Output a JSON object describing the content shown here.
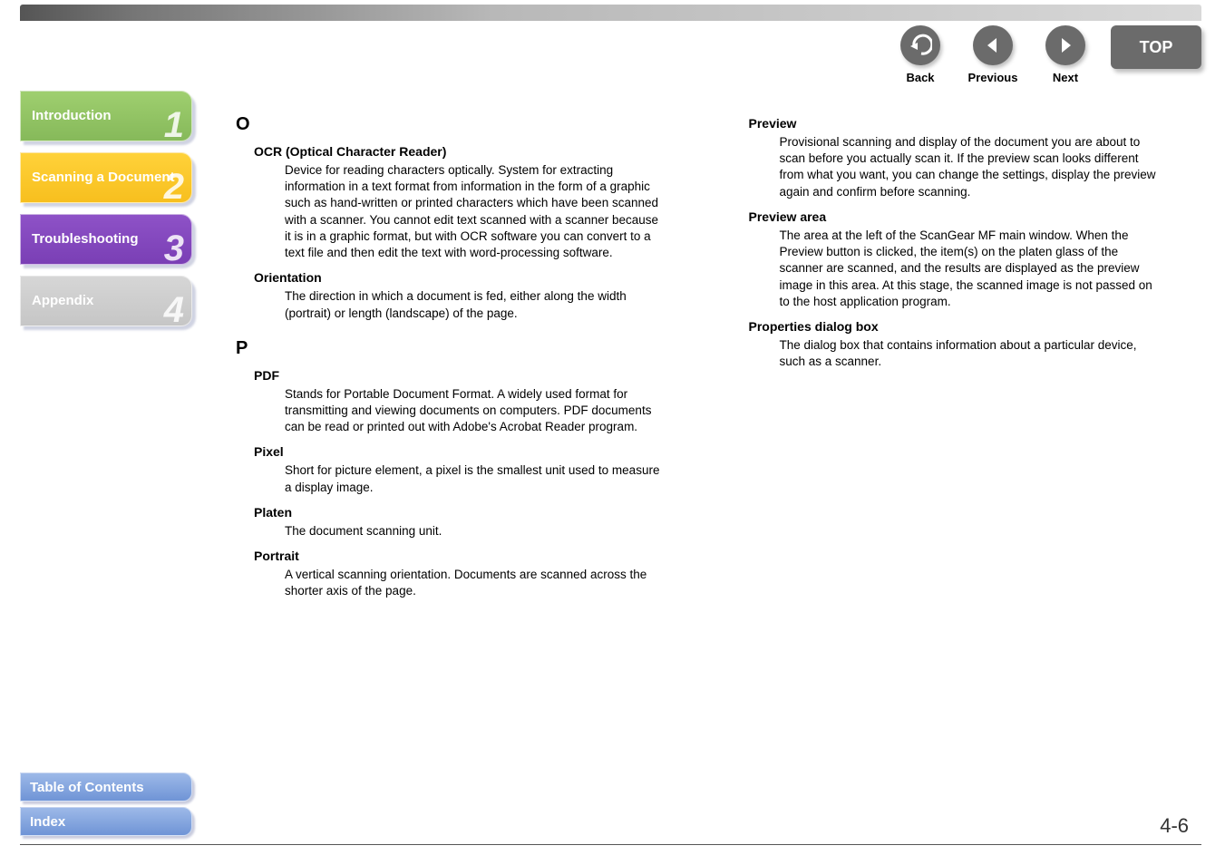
{
  "nav": {
    "back": {
      "label": "Back"
    },
    "previous": {
      "label": "Previous"
    },
    "next": {
      "label": "Next"
    },
    "top": {
      "label": "TOP"
    }
  },
  "sidebar": {
    "tabs": [
      {
        "label": "Introduction",
        "num": "1"
      },
      {
        "label": "Scanning a Document",
        "num": "2"
      },
      {
        "label": "Troubleshooting",
        "num": "3"
      },
      {
        "label": "Appendix",
        "num": "4"
      }
    ],
    "links": {
      "toc": "Table of Contents",
      "index": "Index"
    }
  },
  "glossary": {
    "left": {
      "letters": [
        {
          "letter": "O",
          "entries": [
            {
              "term": "OCR (Optical Character Reader)",
              "def": "Device for reading characters optically. System for extracting information in a text format from information in the form of a graphic such as hand-written or printed characters which have been scanned with a scanner. You cannot edit text scanned with a scanner because it is in a graphic format, but with OCR software you can convert to a text file and then edit the text with word-processing software."
            },
            {
              "term": "Orientation",
              "def": "The direction in which a document is fed, either along the width (portrait) or length (landscape) of the page."
            }
          ]
        },
        {
          "letter": "P",
          "entries": [
            {
              "term": "PDF",
              "def": "Stands for Portable Document Format. A widely used format for transmitting and viewing documents on computers. PDF documents can be read or printed out with Adobe's Acrobat Reader program."
            },
            {
              "term": "Pixel",
              "def": "Short for picture element, a pixel is the smallest unit used to measure a display image."
            },
            {
              "term": "Platen",
              "def": "The document scanning unit."
            },
            {
              "term": "Portrait",
              "def": "A vertical scanning orientation. Documents are scanned across the shorter axis of the page."
            }
          ]
        }
      ]
    },
    "right": {
      "entries": [
        {
          "term": "Preview",
          "def": "Provisional scanning and display of the document you are about to scan before you actually scan it. If the preview scan looks different from what you want, you can change the settings, display the preview again and confirm before scanning."
        },
        {
          "term": "Preview area",
          "def": "The area at the left of the ScanGear MF main window. When the Preview button is clicked, the item(s) on the platen glass of the scanner are scanned, and the results are displayed as the preview image in this area. At this stage, the scanned image is not passed on to the host application program."
        },
        {
          "term": "Properties dialog box",
          "def": "The dialog box that contains information about a particular device, such as a scanner."
        }
      ]
    }
  },
  "page_number": "4-6"
}
